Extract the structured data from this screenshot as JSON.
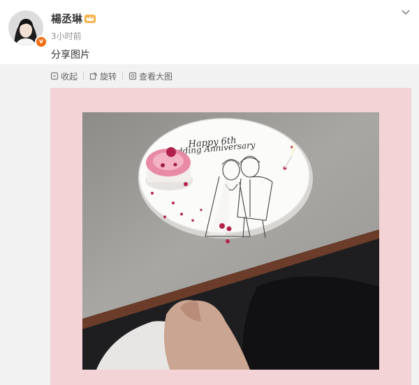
{
  "post": {
    "username": "楊丞琳",
    "timestamp": "3小时前",
    "text": "分享图片",
    "verified_color": "#f26d12"
  },
  "toolbar": {
    "collect_label": "收起",
    "rotate_label": "旋转",
    "view_large_label": "查看大图"
  },
  "photo": {
    "plate_text_line1": "Happy 6th",
    "plate_text_line2": "Wedding Anniversary",
    "background_color": "#f4d3d7"
  },
  "icons": [
    "chevron-down-icon",
    "verified-icon",
    "crown-badge-icon",
    "collect-icon",
    "rotate-icon",
    "zoom-icon"
  ]
}
